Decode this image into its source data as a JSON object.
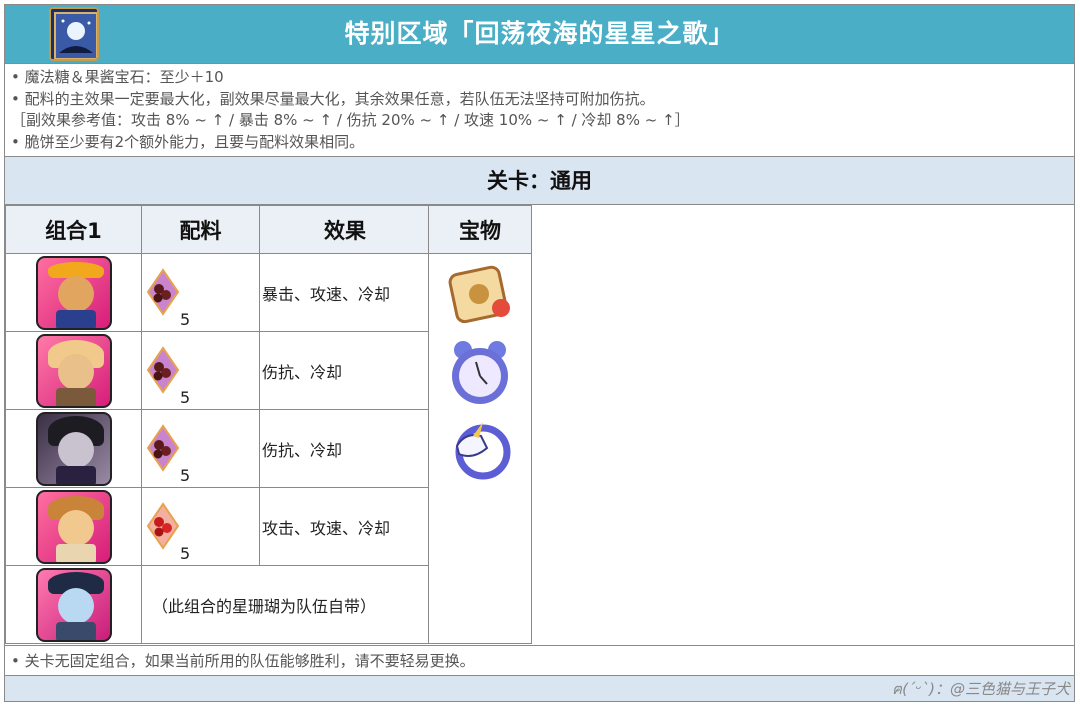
{
  "chart_data": {
    "type": "table",
    "title": "特别区域「回荡夜海的星星之歌」",
    "notes": [
      "• 魔法糖＆果酱宝石：至少＋10",
      "• 配料的主效果一定要最大化，副效果尽量最大化，其余效果任意，若队伍无法坚持可附加伤抗。",
      "［副效果参考值：攻击 8% ~ ↑ / 暴击 8% ~ ↑ / 伤抗 20% ~ ↑ / 攻速 10% ~ ↑ / 冷却 8% ~ ↑］",
      "• 脆饼至少要有2个额外能力，且要与配料效果相同。"
    ],
    "stage": "关卡：通用",
    "columns": [
      "组合1",
      "配料",
      "效果",
      "宝物"
    ],
    "rows": [
      {
        "cookie_icon": "cowboy-cookie-avatar-icon",
        "jam_icon": "brown-jam-icon",
        "jam_count": "5",
        "effect": "暴击、攻速、冷却"
      },
      {
        "cookie_icon": "blonde-cookie-avatar-icon",
        "jam_icon": "brown-jam-icon",
        "jam_count": "5",
        "effect": "伤抗、冷却"
      },
      {
        "cookie_icon": "dark-cookie-avatar-icon",
        "jam_icon": "brown-jam-icon",
        "jam_count": "5",
        "effect": "伤抗、冷却"
      },
      {
        "cookie_icon": "spiky-hair-cookie-avatar-icon",
        "jam_icon": "red-jam-icon",
        "jam_count": "5",
        "effect": "攻击、攻速、冷却"
      },
      {
        "cookie_icon": "pirate-cookie-avatar-icon",
        "combo_note": "（此组合的星珊瑚为队伍自带）"
      }
    ],
    "treasures": [
      "golden-scroll-icon",
      "clock-icon",
      "unicorn-ring-icon"
    ],
    "footer": "• 关卡无固定组合，如果当前所用的队伍能够胜利，请不要轻易更换。",
    "credit": "ฅ(ˊᵕˋ)：@三色猫与王子犬",
    "colors": {
      "title_bar": "#49aec6",
      "header_bg": "#d9e5f1",
      "th_bg": "#eaf0f6"
    }
  }
}
